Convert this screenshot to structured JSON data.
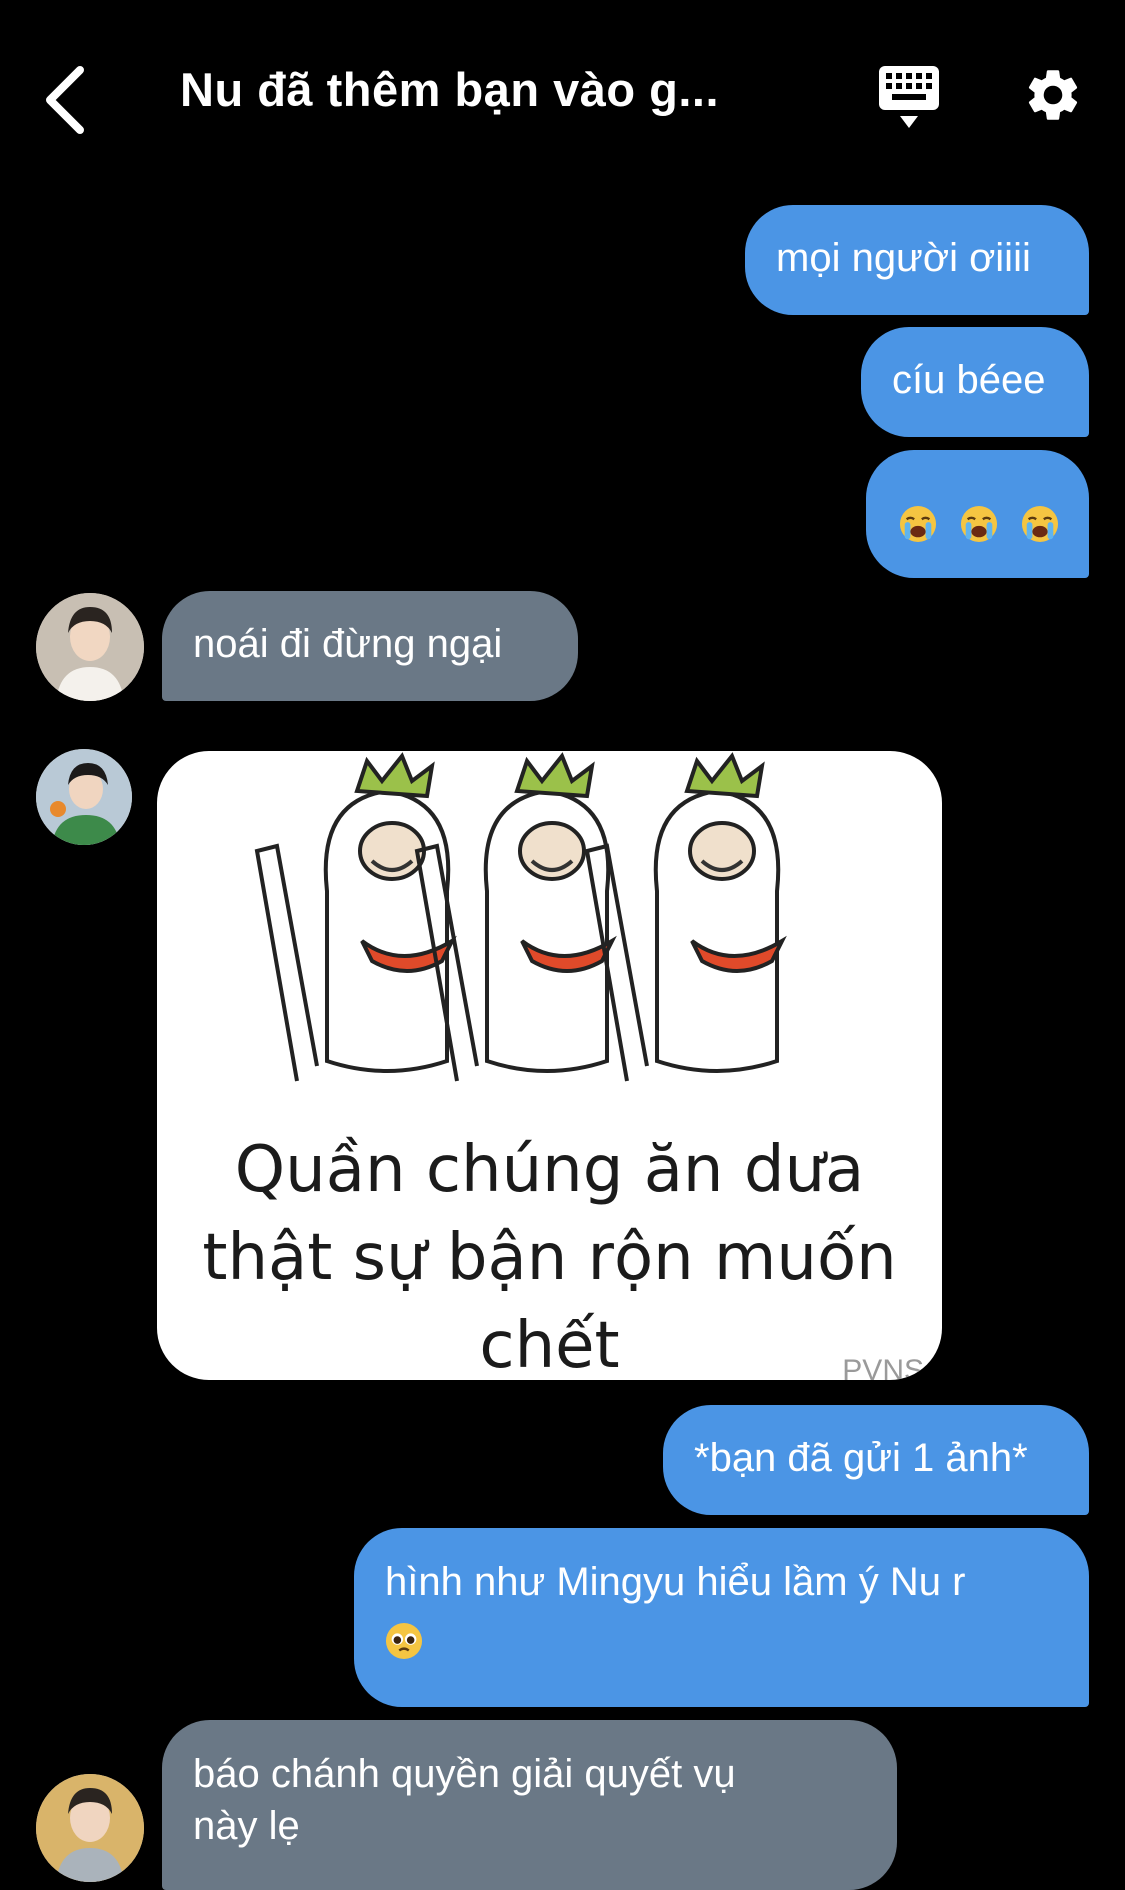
{
  "header": {
    "title": "Nu đã thêm bạn vào g...",
    "back_icon": "chevron-left-icon",
    "keyboard_icon": "keyboard-icon",
    "settings_icon": "gear-icon"
  },
  "colors": {
    "background": "#000000",
    "outgoing_bubble": "#4b95e5",
    "incoming_bubble": "#6a7886",
    "text": "#ffffff"
  },
  "messages": [
    {
      "direction": "outgoing",
      "text": "mọi người ơiiii"
    },
    {
      "direction": "outgoing",
      "text": "cíu béee"
    },
    {
      "direction": "outgoing",
      "emojis": [
        "crying-face",
        "crying-face",
        "crying-face"
      ]
    },
    {
      "direction": "incoming",
      "sender_avatar": "avatar-1",
      "text": "noái đi đừng ngại"
    },
    {
      "direction": "incoming",
      "sender_avatar": "avatar-2",
      "type": "image",
      "image": {
        "caption_line1": "Quần chúng ăn dưa",
        "caption_line2": "thật sự bận rộn muốn",
        "caption_line3": "chết",
        "watermark": "PVNS"
      }
    },
    {
      "direction": "outgoing",
      "text": "*bạn đã gửi 1 ảnh*"
    },
    {
      "direction": "outgoing",
      "text": "hình như Mingyu hiểu lầm ý Nu r",
      "emoji": "pleading-face"
    },
    {
      "direction": "incoming",
      "sender_avatar": "avatar-3",
      "text_line1": "báo chánh quyền giải quyết vụ",
      "text_line2": "này lẹ"
    }
  ]
}
